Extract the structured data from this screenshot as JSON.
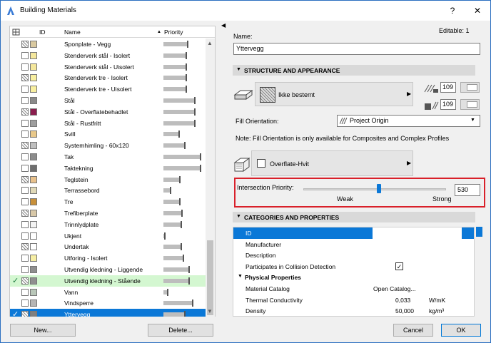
{
  "window": {
    "title": "Building Materials",
    "help": "?",
    "close": "✕"
  },
  "list": {
    "headers": {
      "id": "ID",
      "name": "Name",
      "priority": "Priority"
    },
    "rows": [
      {
        "name": "Sponplate - Vegg",
        "p": 0.62,
        "c": "#d9c9a0",
        "check": ""
      },
      {
        "name": "Stenderverk stål - Isolert",
        "p": 0.58,
        "c": "#f4e79c",
        "check": ""
      },
      {
        "name": "Stenderverk stål - Uisolert",
        "p": 0.58,
        "c": "#f4e79c",
        "check": ""
      },
      {
        "name": "Stenderverk tre - Isolert",
        "p": 0.58,
        "c": "#f8efa0",
        "check": ""
      },
      {
        "name": "Stenderverk tre - Uisolert",
        "p": 0.58,
        "c": "#f8efa0",
        "check": ""
      },
      {
        "name": "Stål",
        "p": 0.8,
        "c": "#8a8a8a",
        "check": ""
      },
      {
        "name": "Stål - Overflatebehadlet",
        "p": 0.8,
        "c": "#8b1e4e",
        "check": ""
      },
      {
        "name": "Stål - Rustfritt",
        "p": 0.8,
        "c": "#9e9e9e",
        "check": ""
      },
      {
        "name": "Svill",
        "p": 0.4,
        "c": "#e8c88a",
        "check": ""
      },
      {
        "name": "Systemhimling - 60x120",
        "p": 0.55,
        "c": "#bfbfbf",
        "check": ""
      },
      {
        "name": "Tak",
        "p": 0.95,
        "c": "#8c8c8c",
        "check": ""
      },
      {
        "name": "Taktekning",
        "p": 0.95,
        "c": "#6e6e6e",
        "check": ""
      },
      {
        "name": "Teglstein",
        "p": 0.42,
        "c": "#e8c18c",
        "check": ""
      },
      {
        "name": "Terrassebord",
        "p": 0.18,
        "c": "#e0d9b8",
        "check": ""
      },
      {
        "name": "Tre",
        "p": 0.42,
        "c": "#c8903a",
        "check": ""
      },
      {
        "name": "Trefiberplate",
        "p": 0.48,
        "c": "#d8c8a8",
        "check": ""
      },
      {
        "name": "Trinnlydplate",
        "p": 0.45,
        "c": "#f3f3f3",
        "check": ""
      },
      {
        "name": "Ukjent",
        "p": 0.02,
        "c": "#ffffff",
        "check": ""
      },
      {
        "name": "Undertak",
        "p": 0.45,
        "c": "#ffffff",
        "check": ""
      },
      {
        "name": "Utforing - Isolert",
        "p": 0.5,
        "c": "#f6eea4",
        "check": ""
      },
      {
        "name": "Utvendig kledning - Liggende",
        "p": 0.65,
        "c": "#8f8f8f",
        "check": ""
      },
      {
        "name": "Utvendig kledning - Stående",
        "p": 0.65,
        "c": "#8f8f8f",
        "check": "✓"
      },
      {
        "name": "Vann",
        "p": 0.1,
        "c": "#b9c7b9",
        "check": ""
      },
      {
        "name": "Vindsperre",
        "p": 0.75,
        "c": "#b5b5b5",
        "check": ""
      },
      {
        "name": "Yttervegg",
        "p": 0.55,
        "c": "#7f7f7f",
        "check": "✓"
      }
    ],
    "new_button": "New...",
    "delete_button": "Delete..."
  },
  "detail": {
    "name_label": "Name:",
    "editable": "Editable: 1",
    "name_value": "Yttervegg",
    "structure_section": "STRUCTURE AND APPEARANCE",
    "fill_name": "Ikke bestemt",
    "pen1": "109",
    "pen2": "109",
    "fill_orientation_label": "Fill Orientation:",
    "fill_orientation_value": "Project Origin",
    "note": "Note: Fill Orientation is only available for Composites and Complex Profiles",
    "surface_name": "Overflate-Hvit",
    "intersection_label": "Intersection Priority:",
    "weak": "Weak",
    "strong": "Strong",
    "intersection_value": "530",
    "intersection_level": 0.53,
    "categories_section": "CATEGORIES AND PROPERTIES",
    "properties": [
      {
        "key": "ID",
        "value": "",
        "unit": "",
        "sel": true
      },
      {
        "key": "Manufacturer",
        "value": "",
        "unit": ""
      },
      {
        "key": "Description",
        "value": "",
        "unit": ""
      },
      {
        "key": "Participates in Collision Detection",
        "value": "✓",
        "unit": "",
        "checkbox": true
      },
      {
        "key": "Physical Properties",
        "value": "",
        "unit": "",
        "group": true
      },
      {
        "key": "Material Catalog",
        "value": "Open Catalog...",
        "unit": ""
      },
      {
        "key": "Thermal Conductivity",
        "value": "0,033",
        "unit": "W/mK"
      },
      {
        "key": "Density",
        "value": "50,000",
        "unit": "kg/m³"
      }
    ],
    "cancel": "Cancel",
    "ok": "OK"
  }
}
